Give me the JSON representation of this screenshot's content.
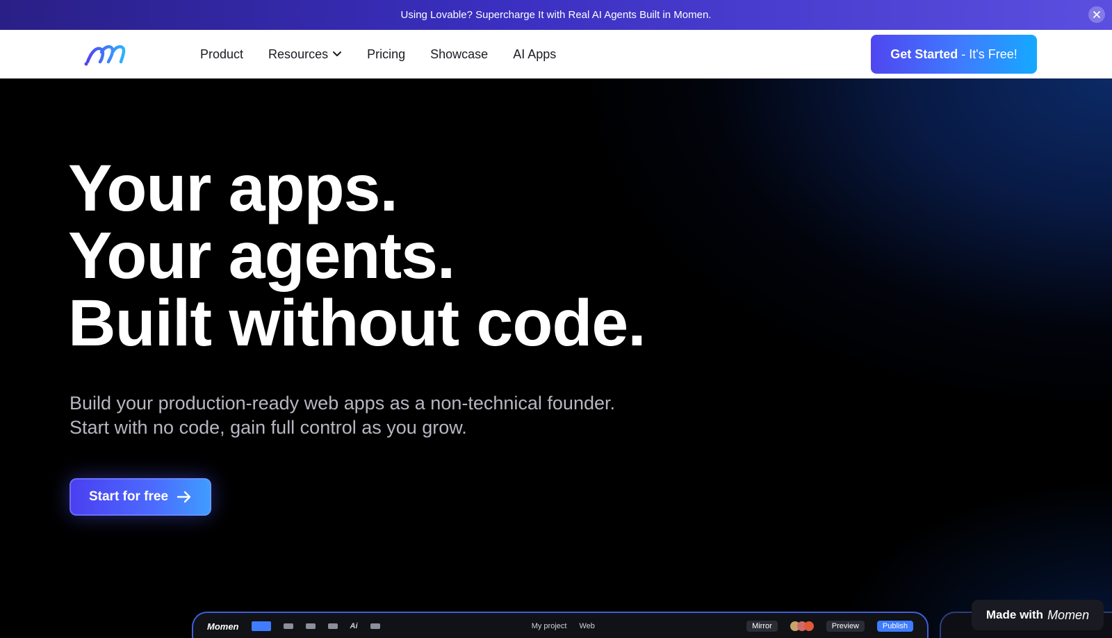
{
  "announcement": {
    "text": "Using Lovable? Supercharge It with Real AI Agents Built in Momen."
  },
  "nav": {
    "items": [
      {
        "label": "Product"
      },
      {
        "label": "Resources"
      },
      {
        "label": "Pricing"
      },
      {
        "label": "Showcase"
      },
      {
        "label": "AI Apps"
      }
    ],
    "cta_bold": "Get Started",
    "cta_rest": " - It's Free!"
  },
  "hero": {
    "headline_lines": [
      "Your apps.",
      "Your agents.",
      "Built without code."
    ],
    "sub_lines": [
      "Build your production-ready web apps as a non-technical founder.",
      "Start with no code, gain full control as you grow."
    ],
    "start_label": "Start for free"
  },
  "editor": {
    "brand": "Momen",
    "project": "My project",
    "platform": "Web",
    "mirror": "Mirror",
    "preview": "Preview",
    "publish": "Publish",
    "ai": "Ai"
  },
  "made_with": {
    "label": "Made with",
    "brand": "Momen"
  },
  "colors": {
    "accent": "#4f46f0",
    "accent_light": "#15a9ff",
    "banner": "#3a2fc0"
  }
}
